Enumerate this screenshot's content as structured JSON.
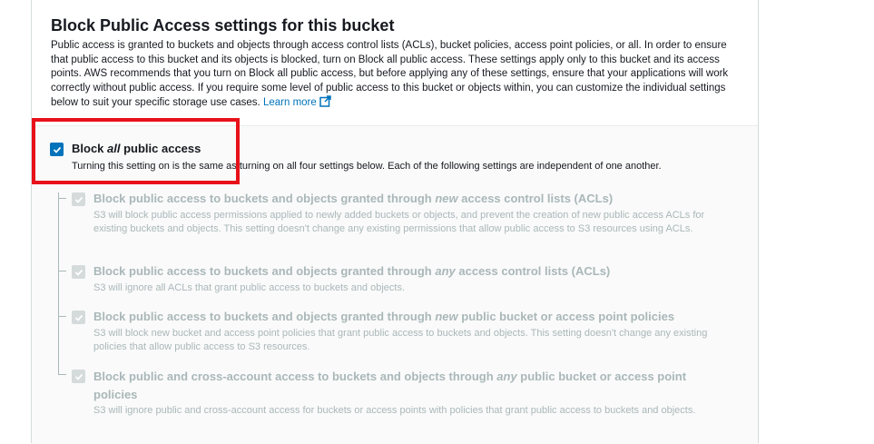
{
  "section": {
    "title": "Block Public Access settings for this bucket",
    "description": "Public access is granted to buckets and objects through access control lists (ACLs), bucket policies, access point policies, or all. In order to ensure that public access to this bucket and its objects is blocked, turn on Block all public access. These settings apply only to this bucket and its access points. AWS recommends that you turn on Block all public access, but before applying any of these settings, ensure that your applications will work correctly without public access. If you require some level of public access to this bucket or objects within, you can customize the individual settings below to suit your specific storage use cases.",
    "learn_more": "Learn more"
  },
  "block_all": {
    "label_pre": "Block ",
    "label_em": "all",
    "label_post": " public access",
    "description": "Turning this setting on is the same as turning on all four settings below. Each of the following settings are independent of one another.",
    "checked": true
  },
  "settings": [
    {
      "label_pre": "Block public access to buckets and objects granted through ",
      "label_em": "new",
      "label_post": " access control lists (ACLs)",
      "description": "S3 will block public access permissions applied to newly added buckets or objects, and prevent the creation of new public access ACLs for existing buckets and objects. This setting doesn't change any existing permissions that allow public access to S3 resources using ACLs.",
      "checked": true,
      "disabled": true
    },
    {
      "label_pre": "Block public access to buckets and objects granted through ",
      "label_em": "any",
      "label_post": " access control lists (ACLs)",
      "description": "S3 will ignore all ACLs that grant public access to buckets and objects.",
      "checked": true,
      "disabled": true
    },
    {
      "label_pre": "Block public access to buckets and objects granted through ",
      "label_em": "new",
      "label_post": " public bucket or access point policies",
      "description": "S3 will block new bucket and access point policies that grant public access to buckets and objects. This setting doesn't change any existing policies that allow public access to S3 resources.",
      "checked": true,
      "disabled": true
    },
    {
      "label_pre": "Block public and cross-account access to buckets and objects through ",
      "label_em": "any",
      "label_post": " public bucket or access point policies",
      "description": "S3 will ignore public and cross-account access for buckets or access points with policies that grant public access to buckets and objects.",
      "checked": true,
      "disabled": true
    }
  ],
  "colors": {
    "accent": "#0073bb",
    "highlight": "#e8111a",
    "disabled": "#aab7b8"
  },
  "icons": {
    "external_link": "external-link-icon",
    "checkmark": "checkmark-icon"
  }
}
